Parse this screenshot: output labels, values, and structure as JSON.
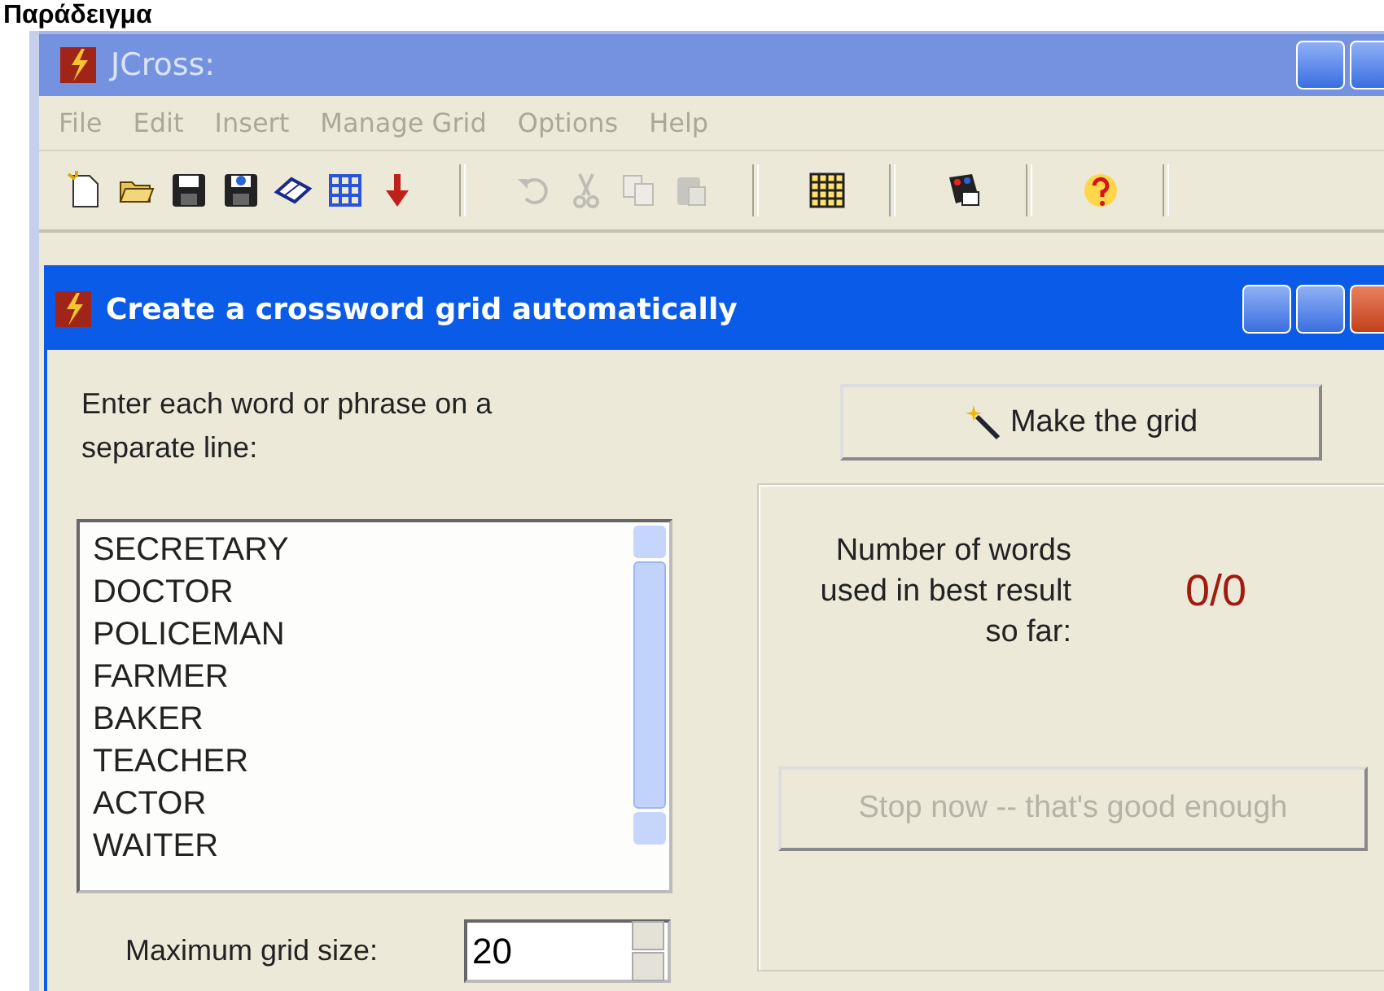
{
  "heading": "Παράδειγμα",
  "window": {
    "title": "JCross:",
    "active": false
  },
  "menu": [
    {
      "label": "File",
      "disabled": true
    },
    {
      "label": "Edit",
      "disabled": true
    },
    {
      "label": "Insert",
      "disabled": true
    },
    {
      "label": "Manage Grid",
      "disabled": true
    },
    {
      "label": "Options",
      "disabled": true
    },
    {
      "label": "Help",
      "disabled": true
    }
  ],
  "toolbar": [
    [
      {
        "disabled": false
      },
      {
        "disabled": false
      },
      {
        "disabled": false
      },
      {
        "disabled": false
      },
      {
        "disabled": false
      },
      {
        "disabled": false
      },
      {
        "disabled": false
      }
    ],
    [
      {
        "disabled": true
      },
      {
        "disabled": true
      },
      {
        "disabled": true
      },
      {
        "disabled": true
      }
    ],
    [
      {
        "disabled": false
      }
    ],
    [
      {
        "disabled": false
      }
    ],
    [
      {
        "disabled": false
      }
    ]
  ],
  "dialog": {
    "title": "Create a crossword grid automatically",
    "active": true,
    "instruction": "Enter each word or phrase on a separate line:",
    "words": [
      "SECRETARY",
      "DOCTOR",
      "POLICEMAN",
      "FARMER",
      "BAKER",
      "TEACHER",
      "ACTOR",
      "WAITER"
    ],
    "grid_size_label": "Maximum grid size:",
    "grid_size": "20",
    "make_button": {
      "label": "Make the grid",
      "disabled": false
    },
    "result_label": "Number of words used in best result so far:",
    "result": "0/0",
    "stop_button": {
      "label": "Stop now -- that's good enough",
      "disabled": true
    }
  }
}
